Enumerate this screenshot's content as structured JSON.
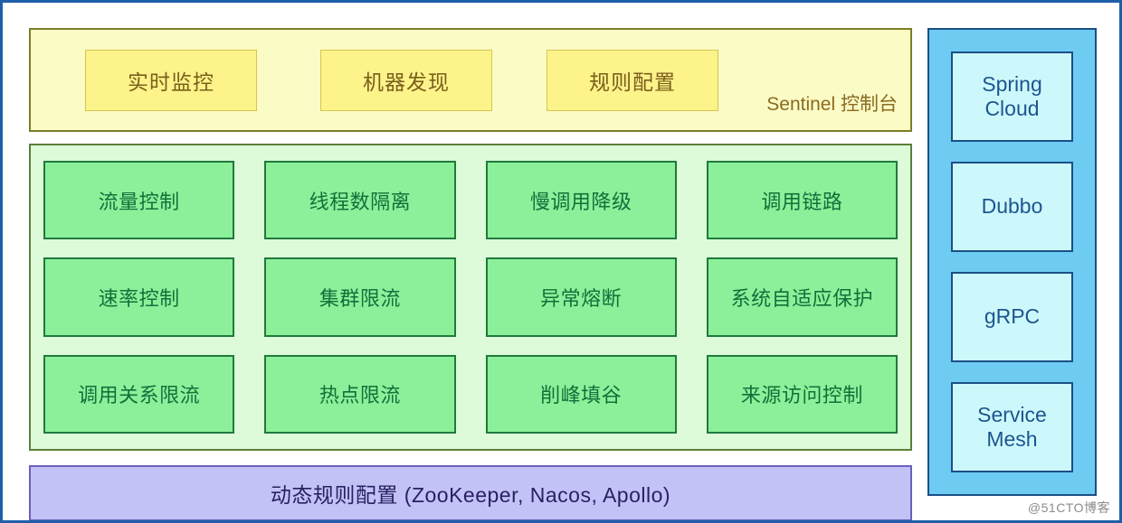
{
  "diagram": {
    "title": "Sentinel 控制台",
    "console": {
      "caption": "Sentinel 控制台",
      "items": [
        {
          "label": "实时监控"
        },
        {
          "label": "机器发现"
        },
        {
          "label": "规则配置"
        }
      ]
    },
    "features": {
      "items": [
        {
          "label": "流量控制"
        },
        {
          "label": "线程数隔离"
        },
        {
          "label": "慢调用降级"
        },
        {
          "label": "调用链路"
        },
        {
          "label": "速率控制"
        },
        {
          "label": "集群限流"
        },
        {
          "label": "异常熔断"
        },
        {
          "label": "系统自适应保护"
        },
        {
          "label": "调用关系限流"
        },
        {
          "label": "热点限流"
        },
        {
          "label": "削峰填谷"
        },
        {
          "label": "来源访问控制"
        }
      ]
    },
    "datasource": {
      "label": "动态规则配置 (ZooKeeper, Nacos, Apollo)"
    },
    "adapters": {
      "items": [
        {
          "label": "Spring\nCloud",
          "line1": "Spring",
          "line2": "Cloud"
        },
        {
          "label": "Dubbo",
          "line1": "Dubbo",
          "line2": ""
        },
        {
          "label": "gRPC",
          "line1": "gRPC",
          "line2": ""
        },
        {
          "label": "Service\nMesh",
          "line1": "Service",
          "line2": "Mesh"
        }
      ]
    },
    "watermark": "@51CTO博客",
    "colors": {
      "frame_border": "#1f5fa8",
      "console_fill": "#fbfbc6",
      "console_border": "#7d7d27",
      "console_box_fill": "#fcf38a",
      "console_box_border": "#d8c64e",
      "console_text": "#7a5f1a",
      "features_fill": "#ddfbd8",
      "features_border": "#5c7f3a",
      "feature_box_fill": "#8cf09a",
      "feature_box_border": "#1f7a3c",
      "feature_text": "#12703a",
      "datasource_fill": "#c2c2f7",
      "datasource_border": "#6a60bc",
      "datasource_text": "#2a2060",
      "adapters_fill": "#6ecbf2",
      "adapters_border": "#1a4f86",
      "adapter_box_fill": "#cdf8fb",
      "adapter_text": "#1d5590"
    }
  }
}
